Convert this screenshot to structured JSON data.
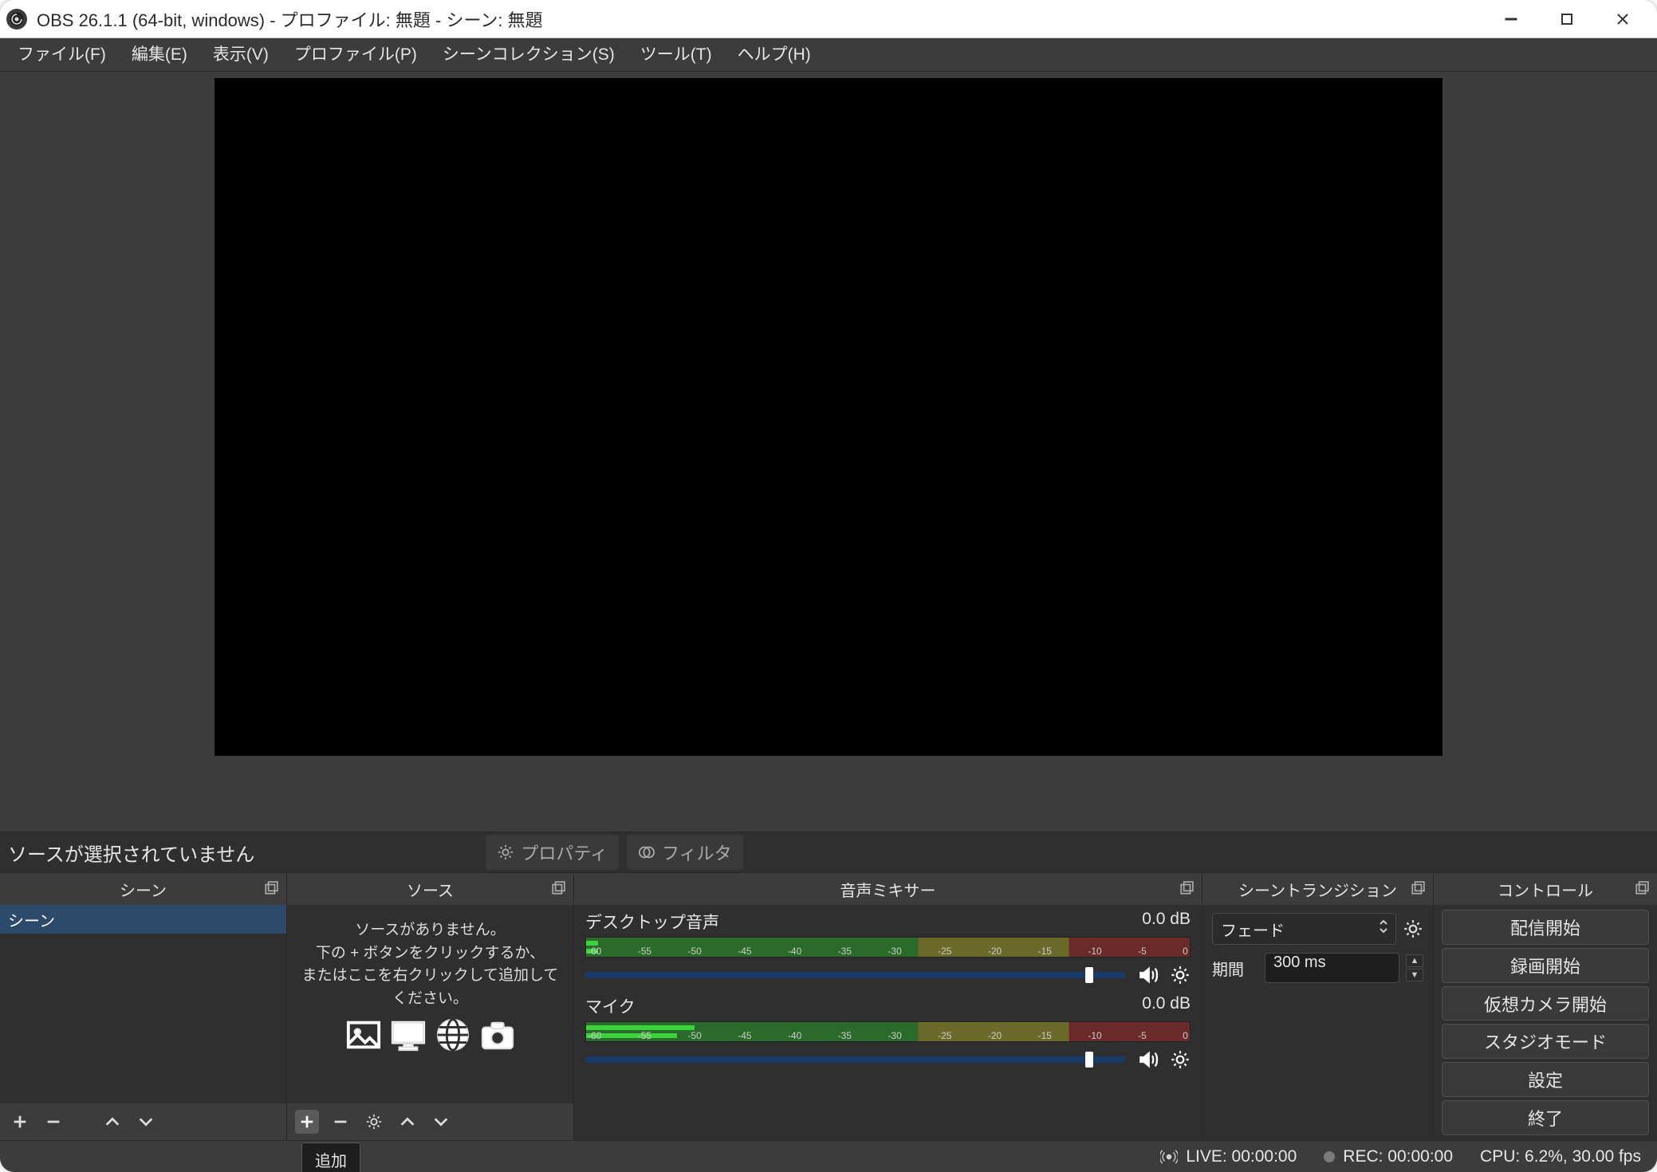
{
  "titlebar": {
    "title": "OBS 26.1.1 (64-bit, windows) - プロファイル: 無題 - シーン: 無題"
  },
  "menu": {
    "file": "ファイル(F)",
    "edit": "編集(E)",
    "view": "表示(V)",
    "profile": "プロファイル(P)",
    "sceneCollection": "シーンコレクション(S)",
    "tools": "ツール(T)",
    "help": "ヘルプ(H)"
  },
  "sourceToolbar": {
    "noSelection": "ソースが選択されていません",
    "properties": "プロパティ",
    "filter": "フィルタ"
  },
  "docks": {
    "scenes": {
      "title": "シーン",
      "item": "シーン"
    },
    "sources": {
      "title": "ソース",
      "emptyLine1": "ソースがありません。",
      "emptyLine2": "下の + ボタンをクリックするか、",
      "emptyLine3": "またはここを右クリックして追加してください。"
    },
    "mixer": {
      "title": "音声ミキサー",
      "ch1": {
        "name": "デスクトップ音声",
        "db": "0.0 dB"
      },
      "ch2": {
        "name": "マイク",
        "db": "0.0 dB"
      },
      "ticks": [
        "-60",
        "-55",
        "-50",
        "-45",
        "-40",
        "-35",
        "-30",
        "-25",
        "-20",
        "-15",
        "-10",
        "-5",
        "0"
      ]
    },
    "transitions": {
      "title": "シーントランジション",
      "selected": "フェード",
      "durationLabel": "期間",
      "durationValue": "300 ms"
    },
    "controls": {
      "title": "コントロール",
      "startStream": "配信開始",
      "startRecord": "録画開始",
      "startVirtualCam": "仮想カメラ開始",
      "studioMode": "スタジオモード",
      "settings": "設定",
      "exit": "終了"
    }
  },
  "status": {
    "live": "LIVE: 00:00:00",
    "rec": "REC: 00:00:00",
    "cpu": "CPU: 6.2%, 30.00 fps"
  },
  "tooltip": {
    "add": "追加"
  }
}
